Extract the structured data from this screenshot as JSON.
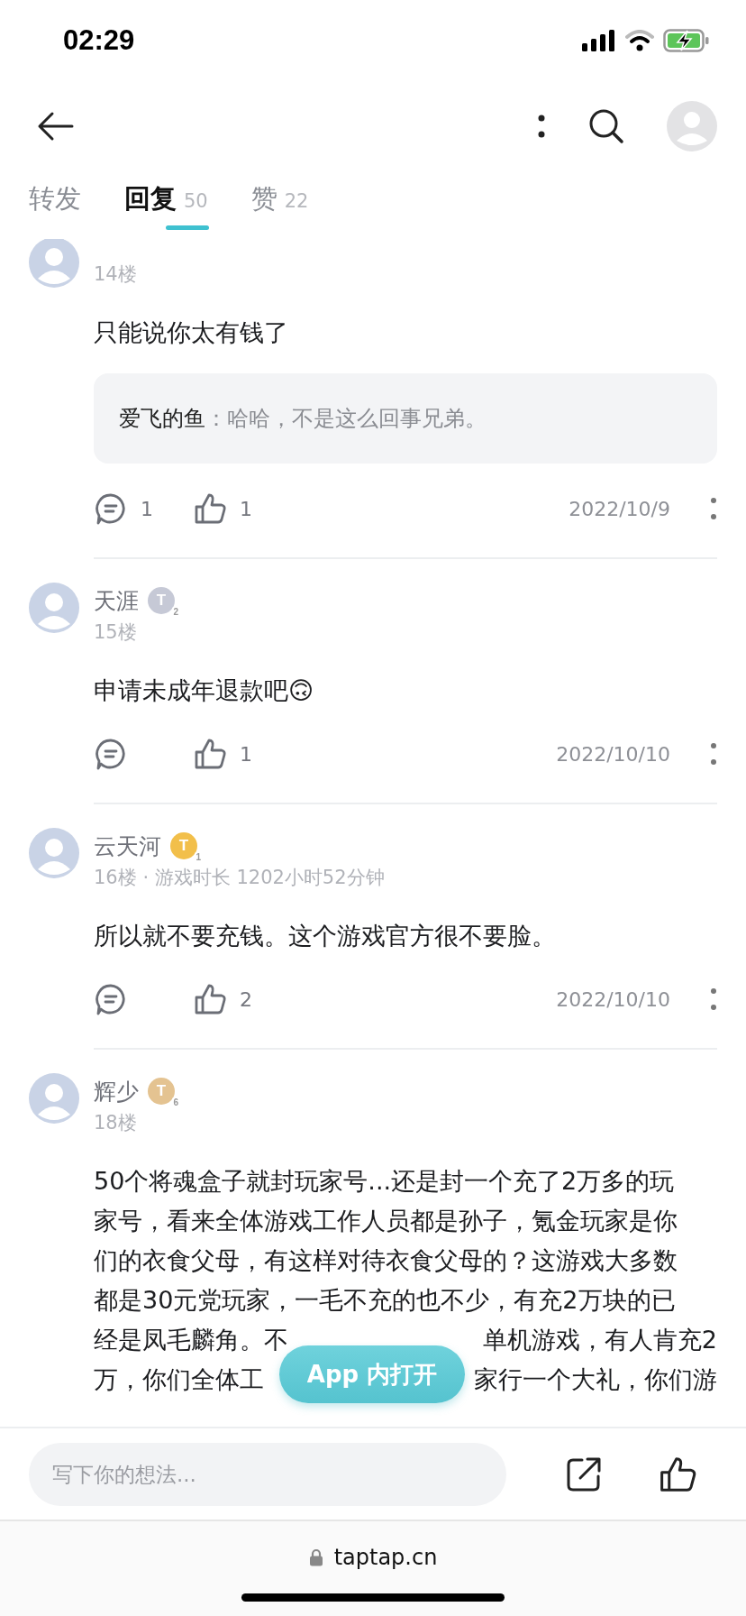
{
  "status_bar": {
    "time": "02:29"
  },
  "tabs": [
    {
      "label": "转发",
      "selected": false
    },
    {
      "label": "回复",
      "count": "50",
      "selected": true
    },
    {
      "label": "赞",
      "count": "22",
      "selected": false
    }
  ],
  "comments": [
    {
      "floor": "14楼",
      "text": "只能说你太有钱了",
      "quote": {
        "author": "爱飞的鱼",
        "text": "：哈哈，不是这么回事兄弟。"
      },
      "reply_count": "1",
      "like_count": "1",
      "date": "2022/10/9"
    },
    {
      "name": "天涯",
      "badge": {
        "letter": "T",
        "level": "2",
        "color": "#c6c9d6"
      },
      "floor": "15楼",
      "text": "申请未成年退款吧🙃",
      "like_count": "1",
      "date": "2022/10/10"
    },
    {
      "name": "云天河",
      "badge": {
        "letter": "T",
        "level": "1",
        "color": "#f2bf4a"
      },
      "floor": "16楼 · 游戏时长 1202小时52分钟",
      "text": "所以就不要充钱。这个游戏官方很不要脸。",
      "like_count": "2",
      "date": "2022/10/10"
    },
    {
      "name": "辉少",
      "badge": {
        "letter": "T",
        "level": "6",
        "color": "#e4c391"
      },
      "floor": "18楼",
      "text_lines": [
        [
          "50个将魂盒子就封玩家号...还是封一个充了2万多的玩"
        ],
        [
          "家号，看来全体游戏工作人员都是孙子，氪金玩家是你"
        ],
        [
          "们的衣食父母，有这样对待衣食父母的？这游戏大多数"
        ],
        [
          "都是30元党玩家，一毛不充的也不少，有充2万块的已"
        ],
        [
          "经是凤毛麟角。不",
          "单机游戏，有人肯充2"
        ],
        [
          "万，你们全体工",
          "家行一个大礼，你们游"
        ]
      ]
    }
  ],
  "open_in_app": "App 内打开",
  "comment_input": {
    "placeholder": "写下你的想法..."
  },
  "browser": {
    "url": "taptap.cn"
  }
}
